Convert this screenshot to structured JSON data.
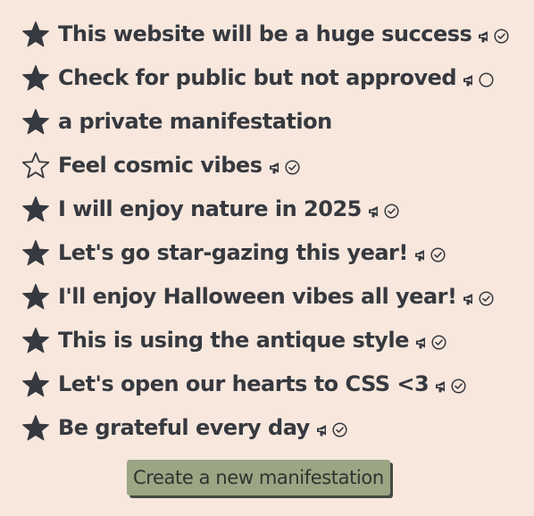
{
  "colors": {
    "background": "#f7e7dd",
    "text": "#36393f",
    "button_bg": "#9aa584",
    "button_shadow": "#434a41"
  },
  "manifestations": [
    {
      "text": "This website will be a huge success",
      "starred": true,
      "public": true,
      "status": "approved"
    },
    {
      "text": "Check for public but not approved",
      "starred": true,
      "public": true,
      "status": "pending"
    },
    {
      "text": "a private manifestation",
      "starred": true,
      "public": false,
      "status": "none"
    },
    {
      "text": "Feel cosmic vibes",
      "starred": false,
      "public": true,
      "status": "approved"
    },
    {
      "text": "I will enjoy nature in 2025",
      "starred": true,
      "public": true,
      "status": "approved"
    },
    {
      "text": "Let's go star-gazing this year!",
      "starred": true,
      "public": true,
      "status": "approved"
    },
    {
      "text": "I'll enjoy Halloween vibes all year!",
      "starred": true,
      "public": true,
      "status": "approved"
    },
    {
      "text": "This is using the antique style",
      "starred": true,
      "public": true,
      "status": "approved"
    },
    {
      "text": "Let's open our hearts to CSS <3",
      "starred": true,
      "public": true,
      "status": "approved"
    },
    {
      "text": "Be grateful every day",
      "starred": true,
      "public": true,
      "status": "approved"
    }
  ],
  "icons": {
    "star_filled": "star-filled-icon",
    "star_outline": "star-outline-icon",
    "public": "megaphone-icon",
    "approved": "check-circle-icon",
    "pending": "empty-circle-icon"
  },
  "create_button": {
    "label": "Create a new manifestation"
  }
}
